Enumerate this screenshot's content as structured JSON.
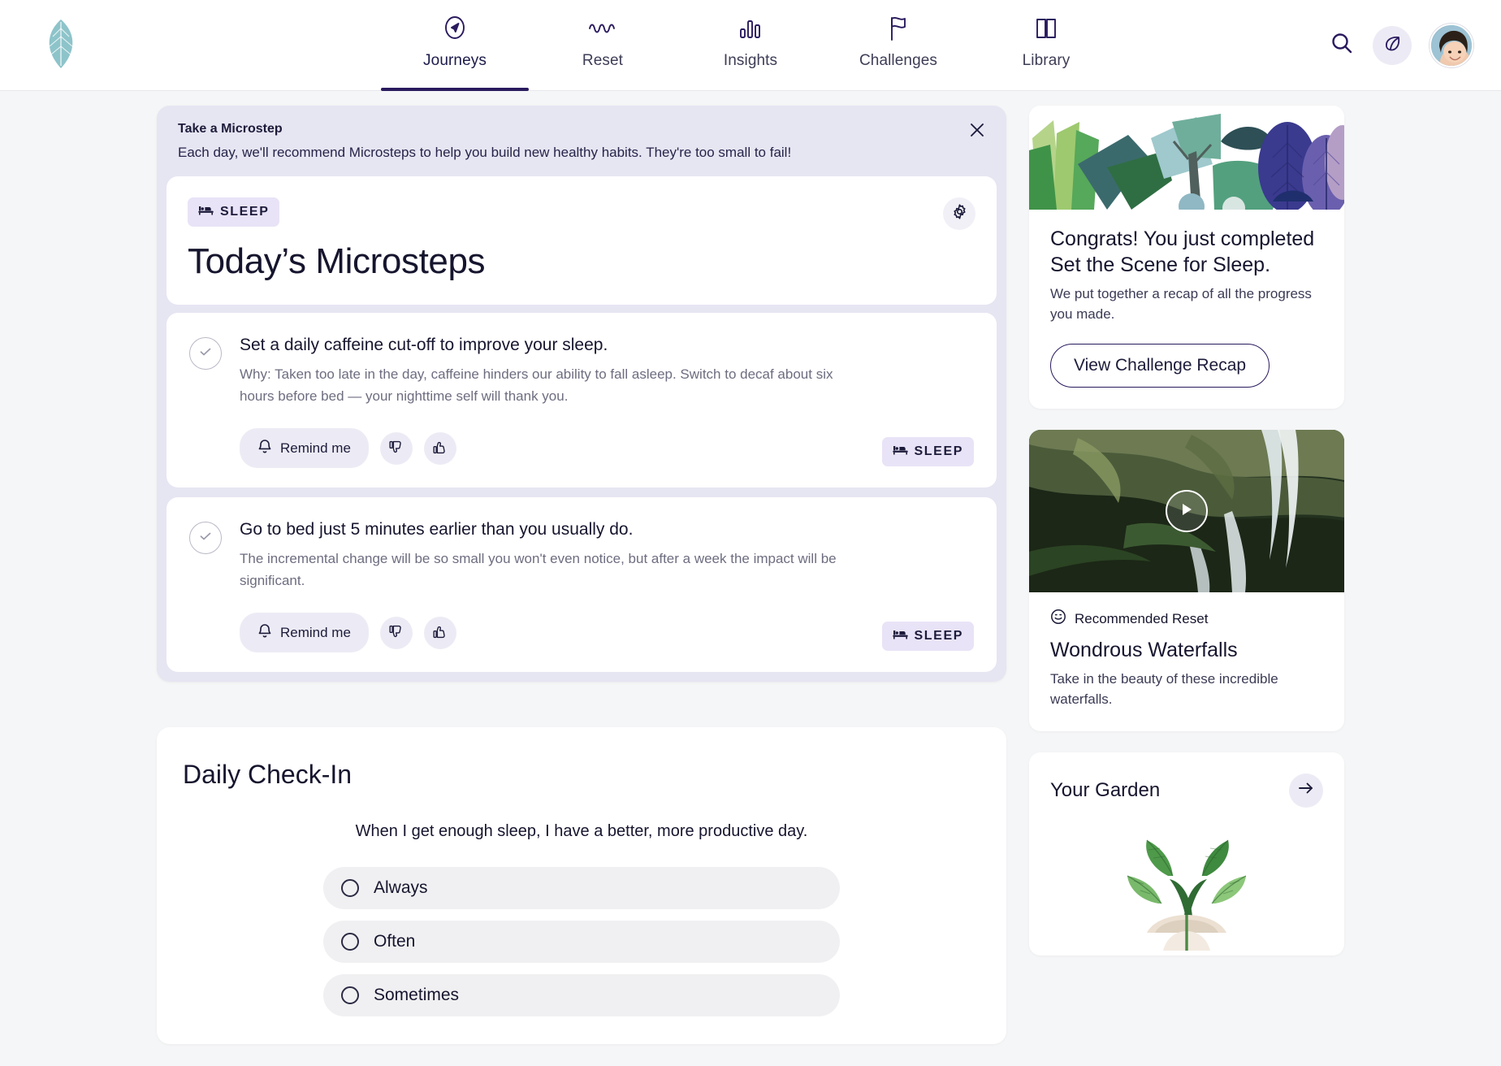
{
  "brand": {
    "logo_icon": "leaf-logo-icon",
    "accent": "#2a1a5e",
    "badge_bg": "#e9e3f7",
    "panel_bg": "#e6e5f2"
  },
  "nav": {
    "items": [
      {
        "label": "Journeys",
        "icon": "compass-icon",
        "active": true
      },
      {
        "label": "Reset",
        "icon": "wave-icon",
        "active": false
      },
      {
        "label": "Insights",
        "icon": "bar-chart-icon",
        "active": false
      },
      {
        "label": "Challenges",
        "icon": "flag-icon",
        "active": false
      },
      {
        "label": "Library",
        "icon": "book-icon",
        "active": false
      }
    ],
    "search_icon": "search-icon",
    "leaf_icon": "leaf-icon",
    "avatar_alt": "user-avatar"
  },
  "microstep_panel": {
    "banner_title": "Take a Microstep",
    "banner_text": "Each day, we'll recommend Microsteps to help you build new healthy habits. They're too small to fail!",
    "close_icon": "close-icon",
    "category_badge": "SLEEP",
    "category_icon": "bed-icon",
    "gear_icon": "gear-icon",
    "heading": "Today’s Microsteps",
    "steps": [
      {
        "title": "Set a daily caffeine cut-off to improve your sleep.",
        "why": "Why: Taken too late in the day, caffeine hinders our ability to fall asleep. Switch to decaf about six hours before bed — your nighttime self will thank you.",
        "remind_label": "Remind me",
        "bell_icon": "bell-icon",
        "thumbs_down_icon": "thumbs-down-icon",
        "thumbs_up_icon": "thumbs-up-icon",
        "badge": "SLEEP",
        "check_icon": "check-circle-icon"
      },
      {
        "title": "Go to bed just 5 minutes earlier than you usually do.",
        "why": "The incremental change will be so small you won't even notice, but after a week the impact will be significant.",
        "remind_label": "Remind me",
        "bell_icon": "bell-icon",
        "thumbs_down_icon": "thumbs-down-icon",
        "thumbs_up_icon": "thumbs-up-icon",
        "badge": "SLEEP",
        "check_icon": "check-circle-icon"
      }
    ]
  },
  "daily_checkin": {
    "title": "Daily Check-In",
    "question": "When I get enough sleep, I have a better, more productive day.",
    "options": [
      {
        "label": "Always",
        "selected": false
      },
      {
        "label": "Often",
        "selected": false
      },
      {
        "label": "Sometimes",
        "selected": false
      }
    ]
  },
  "sidebar": {
    "challenge_card": {
      "image_alt": "tropical-plants-illustration",
      "heading_line1": "Congrats! You just completed",
      "heading_line2": "Set the Scene for Sleep.",
      "body": "We put together a recap of all the progress you made.",
      "button_label": "View Challenge Recap"
    },
    "reset_card": {
      "image_alt": "waterfall-photo",
      "play_icon": "play-icon",
      "eyebrow_icon": "smiley-icon",
      "eyebrow": "Recommended Reset",
      "title": "Wondrous Waterfalls",
      "body": "Take in the beauty of these incredible waterfalls."
    },
    "garden_card": {
      "title": "Your Garden",
      "arrow_icon": "arrow-right-icon",
      "plant_alt": "sprout-illustration"
    }
  }
}
